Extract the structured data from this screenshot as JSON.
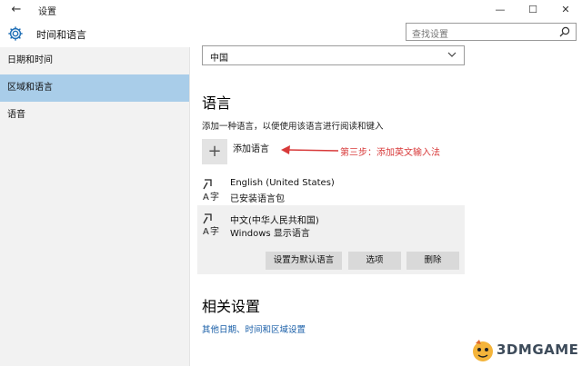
{
  "window": {
    "title": "设置",
    "back": "←",
    "minimize": "—",
    "maximize": "☐",
    "close": "✕"
  },
  "header": {
    "title": "时间和语言",
    "search_placeholder": "查找设置"
  },
  "sidebar": {
    "items": [
      {
        "label": "日期和时间"
      },
      {
        "label": "区域和语言"
      },
      {
        "label": "语音"
      }
    ]
  },
  "region": {
    "value": "中国"
  },
  "languages": {
    "heading": "语言",
    "description": "添加一种语言，以便使用该语言进行阅读和键入",
    "add_icon": "+",
    "add_label": "添加语言",
    "annotation": "第三步：添加英文输入法",
    "items": [
      {
        "name": "English (United States)",
        "status": "已安装语言包"
      },
      {
        "name": "中文(中华人民共和国)",
        "status": "Windows 显示语言"
      }
    ],
    "buttons": {
      "set_default": "设置为默认语言",
      "options": "选项",
      "remove": "删除"
    }
  },
  "related": {
    "heading": "相关设置",
    "link": "其他日期、时间和区域设置"
  },
  "watermark": {
    "text": "3DMGAME"
  },
  "colors": {
    "selected": "#a9cde9",
    "accent_link": "#1a5fa8",
    "annotation": "#d83a3a"
  }
}
